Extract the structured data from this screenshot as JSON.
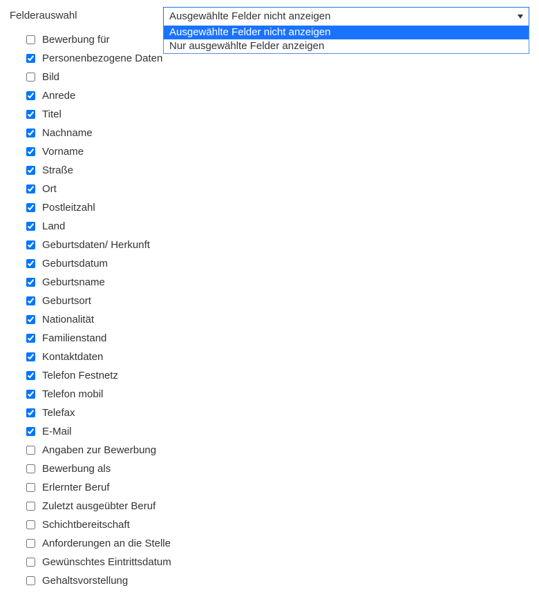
{
  "label": "Felderauswahl",
  "select": {
    "current": "Ausgewählte Felder nicht anzeigen",
    "options": [
      {
        "label": "Ausgewählte Felder nicht anzeigen",
        "selected": true
      },
      {
        "label": "Nur ausgewählte Felder anzeigen",
        "selected": false
      }
    ]
  },
  "fields": [
    {
      "label": "Bewerbung für",
      "checked": false
    },
    {
      "label": "Personenbezogene Daten",
      "checked": true
    },
    {
      "label": "Bild",
      "checked": false
    },
    {
      "label": "Anrede",
      "checked": true
    },
    {
      "label": "Titel",
      "checked": true
    },
    {
      "label": "Nachname",
      "checked": true
    },
    {
      "label": "Vorname",
      "checked": true
    },
    {
      "label": "Straße",
      "checked": true
    },
    {
      "label": "Ort",
      "checked": true
    },
    {
      "label": "Postleitzahl",
      "checked": true
    },
    {
      "label": "Land",
      "checked": true
    },
    {
      "label": "Geburtsdaten/ Herkunft",
      "checked": true
    },
    {
      "label": "Geburtsdatum",
      "checked": true
    },
    {
      "label": "Geburtsname",
      "checked": true
    },
    {
      "label": "Geburtsort",
      "checked": true
    },
    {
      "label": "Nationalität",
      "checked": true
    },
    {
      "label": "Familienstand",
      "checked": true
    },
    {
      "label": "Kontaktdaten",
      "checked": true
    },
    {
      "label": "Telefon Festnetz",
      "checked": true
    },
    {
      "label": "Telefon mobil",
      "checked": true
    },
    {
      "label": "Telefax",
      "checked": true
    },
    {
      "label": "E-Mail",
      "checked": true
    },
    {
      "label": "Angaben zur Bewerbung",
      "checked": false
    },
    {
      "label": "Bewerbung als",
      "checked": false
    },
    {
      "label": "Erlernter Beruf",
      "checked": false
    },
    {
      "label": "Zuletzt ausgeübter Beruf",
      "checked": false
    },
    {
      "label": "Schichtbereitschaft",
      "checked": false
    },
    {
      "label": "Anforderungen an die Stelle",
      "checked": false
    },
    {
      "label": "Gewünschtes Eintrittsdatum",
      "checked": false
    },
    {
      "label": "Gehaltsvorstellung",
      "checked": false
    }
  ]
}
